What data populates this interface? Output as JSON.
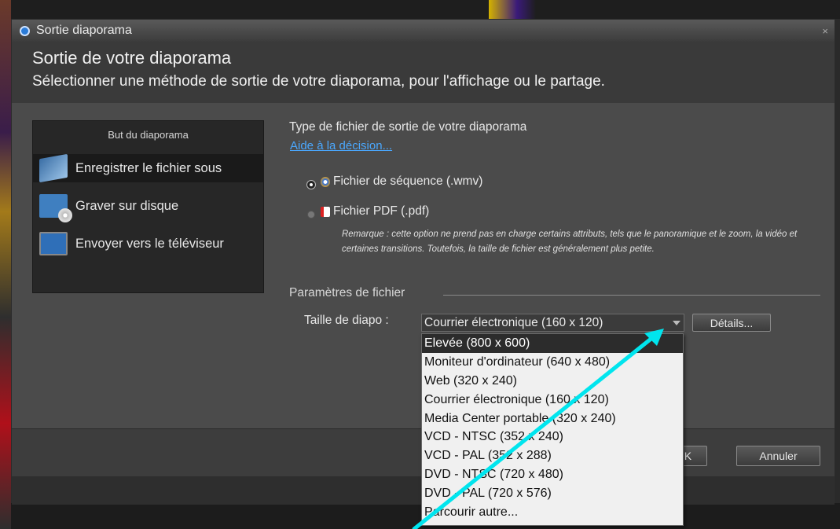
{
  "window": {
    "title": "Sortie diaporama",
    "close": "×",
    "header_title": "Sortie de votre diaporama",
    "header_subtitle": "Sélectionner une méthode de sortie de votre diaporama, pour l'affichage ou le partage."
  },
  "sidebar": {
    "title": "But du diaporama",
    "items": [
      {
        "label": "Enregistrer le fichier sous",
        "icon": "save-file-icon",
        "selected": true
      },
      {
        "label": "Graver sur disque",
        "icon": "burn-disc-icon",
        "selected": false
      },
      {
        "label": "Envoyer vers le téléviseur",
        "icon": "tv-icon",
        "selected": false
      }
    ]
  },
  "main": {
    "type_title": "Type de fichier de sortie de votre diaporama",
    "help_link": "Aide à la décision...",
    "options": [
      {
        "label": "Fichier de séquence (.wmv)",
        "selected": true,
        "icon": "wmv-icon"
      },
      {
        "label": "Fichier PDF (.pdf)",
        "selected": false,
        "icon": "pdf-icon"
      }
    ],
    "remark": "Remarque : cette option ne prend pas en charge certains attributs, tels que le panoramique et le zoom, la vidéo et certaines transitions. Toutefois, la taille de fichier est généralement plus petite.",
    "params_label": "Paramètres de fichier",
    "size_label": "Taille de diapo :",
    "size_value": "Courrier électronique (160 x 120)",
    "details_button": "Détails..."
  },
  "dropdown": {
    "items": [
      "Elevée (800 x 600)",
      "Moniteur d'ordinateur (640 x 480)",
      "Web (320 x 240)",
      "Courrier électronique (160 x 120)",
      "Media Center portable (320 x 240)",
      "VCD - NTSC (352 x 240)",
      "VCD - PAL (352 x 288)",
      "DVD - NTSC (720 x 480)",
      "DVD - PAL (720 x 576)",
      "Parcourir autre..."
    ],
    "highlighted_index": 0
  },
  "footer": {
    "ok_button": "OK",
    "cancel_button": "Annuler"
  },
  "colors": {
    "annotation_arrow": "#00e5ee",
    "link": "#4aa8ff"
  }
}
